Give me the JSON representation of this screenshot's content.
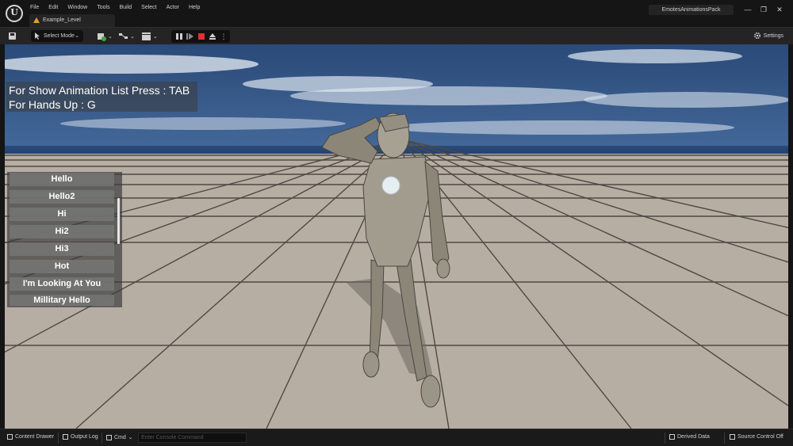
{
  "titlebar": {
    "menu": [
      "File",
      "Edit",
      "Window",
      "Tools",
      "Build",
      "Select",
      "Actor",
      "Help"
    ],
    "level_tab": "Example_Level",
    "project_name": "EmotesAnimationsPack",
    "window_buttons": [
      "—",
      "❐",
      "✕"
    ]
  },
  "toolbar": {
    "select_mode": "Select Mode",
    "settings_label": "Settings"
  },
  "viewport": {
    "hud_lines": [
      "For Show Animation List Press : TAB",
      "For Hands Up : G"
    ],
    "animation_list": [
      "Hello",
      "Hello2",
      "Hi",
      "Hi2",
      "Hi3",
      "Hot",
      "I'm Looking At You",
      "Millitary Hello"
    ]
  },
  "statusbar": {
    "content_drawer": "Content Drawer",
    "output_log": "Output Log",
    "cmd": "Cmd",
    "console_placeholder": "Enter Console Command",
    "derived_data": "Derived Data",
    "source_control": "Source Control Off"
  },
  "colors": {
    "chrome_dark": "#151515",
    "toolbar": "#242424",
    "stop_red": "#e03030",
    "list_button": "#737373"
  }
}
